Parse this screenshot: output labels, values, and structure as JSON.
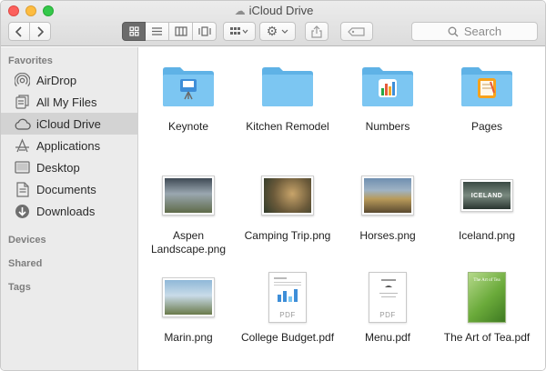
{
  "window": {
    "title": "iCloud Drive"
  },
  "toolbar": {
    "search_placeholder": "Search"
  },
  "sidebar": {
    "favorites_header": "Favorites",
    "items": [
      {
        "label": "AirDrop",
        "icon": "airdrop-icon"
      },
      {
        "label": "All My Files",
        "icon": "all-my-files-icon"
      },
      {
        "label": "iCloud Drive",
        "icon": "icloud-icon",
        "selected": true
      },
      {
        "label": "Applications",
        "icon": "applications-icon"
      },
      {
        "label": "Desktop",
        "icon": "desktop-icon"
      },
      {
        "label": "Documents",
        "icon": "documents-icon"
      },
      {
        "label": "Downloads",
        "icon": "downloads-icon"
      }
    ],
    "devices_header": "Devices",
    "shared_header": "Shared",
    "tags_header": "Tags"
  },
  "files": [
    {
      "name": "Keynote",
      "kind": "folder",
      "badge": "keynote"
    },
    {
      "name": "Kitchen Remodel",
      "kind": "folder",
      "badge": ""
    },
    {
      "name": "Numbers",
      "kind": "folder",
      "badge": "numbers"
    },
    {
      "name": "Pages",
      "kind": "folder",
      "badge": "pages"
    },
    {
      "name": "Aspen Landscape.png",
      "kind": "image",
      "colors": [
        "#3f4a55",
        "#9aa7b0",
        "#5f6b4a"
      ]
    },
    {
      "name": "Camping Trip.png",
      "kind": "image",
      "colors": [
        "#6b5a3a",
        "#c8a46a",
        "#2f3a2a"
      ]
    },
    {
      "name": "Horses.png",
      "kind": "image",
      "colors": [
        "#6f8fb0",
        "#b89a5a",
        "#5a4a30"
      ]
    },
    {
      "name": "Iceland.png",
      "kind": "image",
      "colors": [
        "#3a4a44",
        "#7a8a80",
        "#2a3530"
      ],
      "overlay": "ICELAND"
    },
    {
      "name": "Marin.png",
      "kind": "image",
      "colors": [
        "#8fb8d8",
        "#c9dbe8",
        "#6a7a4a"
      ]
    },
    {
      "name": "College Budget.pdf",
      "kind": "pdf",
      "label": "PDF"
    },
    {
      "name": "Menu.pdf",
      "kind": "pdf",
      "label": "PDF"
    },
    {
      "name": "The Art of Tea.pdf",
      "kind": "tea",
      "cover": "The Art of Tea"
    }
  ],
  "colors": {
    "folder": "#7cc6f2",
    "folder_dark": "#5fb2e6",
    "selected_row": "#d3d3d3"
  }
}
